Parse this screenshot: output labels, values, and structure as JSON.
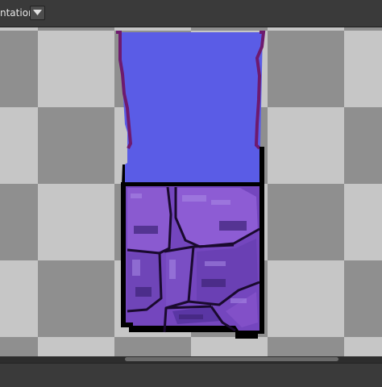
{
  "toolbar": {
    "mode_label": "ntation",
    "dropdown_icon": "chevron-down-icon"
  },
  "canvas": {
    "background": "transparency-checkerboard",
    "sprite": "pixel-art-water-over-purple-rock-tile",
    "colors": {
      "water": "#5a5ce6",
      "water_edge": "#6e1a6e",
      "rock_light": "#8a5ad0",
      "rock_mid": "#7446be",
      "rock_dark": "#512f96",
      "outline": "#000000",
      "checker_light": "#c6c6c6",
      "checker_dark": "#8f8f8f"
    }
  }
}
